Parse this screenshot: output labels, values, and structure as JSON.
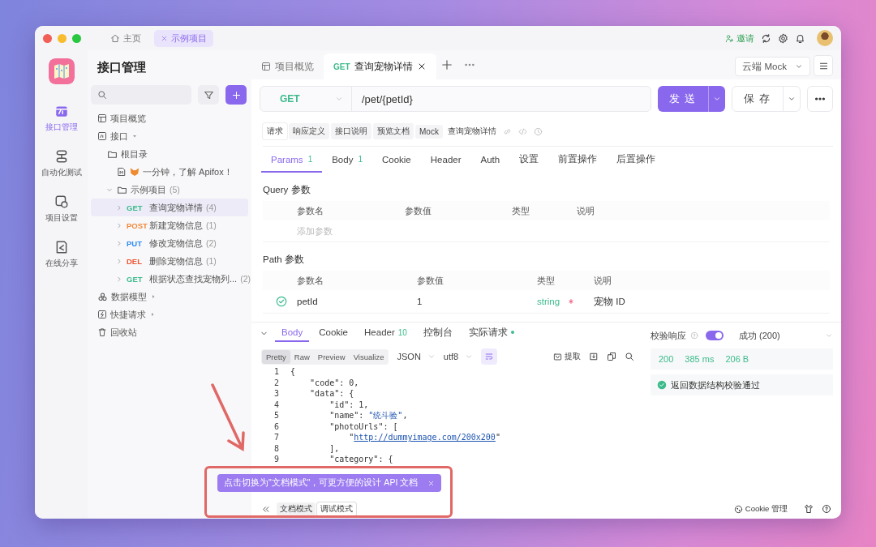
{
  "titlebar": {
    "tabs": [
      {
        "kind": "home",
        "label": "主页",
        "selected": false
      },
      {
        "kind": "project",
        "label": "示例项目",
        "selected": true
      }
    ],
    "invite": "邀请"
  },
  "nav": [
    {
      "kind": "api",
      "label": "接口管理",
      "selected": true
    },
    {
      "kind": "test",
      "label": "自动化测试",
      "selected": false
    },
    {
      "kind": "settings",
      "label": "项目设置",
      "selected": false
    },
    {
      "kind": "share",
      "label": "在线分享",
      "selected": false
    }
  ],
  "sidebar": {
    "title": "接口管理",
    "tree": [
      {
        "kind": "overview",
        "label": "项目概览",
        "selected": false
      },
      {
        "kind": "group",
        "label": "接口",
        "expanded": true,
        "selected": false,
        "children": [
          {
            "kind": "folder",
            "label": "根目录",
            "selected": false,
            "children": [
              {
                "kind": "doc",
                "label": "一分钟，了解 Apifox！",
                "selected": false
              },
              {
                "kind": "folder",
                "label": "示例项目",
                "count": "(5)",
                "expanded": true,
                "selected": false,
                "children": [
                  {
                    "kind": "endpoint",
                    "method": "GET",
                    "color": "#3dbb8c",
                    "label": "查询宠物详情",
                    "count": "(4)",
                    "expanded": false,
                    "selected": true
                  },
                  {
                    "kind": "endpoint",
                    "method": "POST",
                    "color": "#f0883a",
                    "label": "新建宠物信息",
                    "count": "(1)",
                    "expanded": false,
                    "selected": false
                  },
                  {
                    "kind": "endpoint",
                    "method": "PUT",
                    "color": "#2f8cf0",
                    "label": "修改宠物信息",
                    "count": "(2)",
                    "expanded": false,
                    "selected": false
                  },
                  {
                    "kind": "endpoint",
                    "method": "DEL",
                    "color": "#ee5533",
                    "label": "删除宠物信息",
                    "count": "(1)",
                    "expanded": false,
                    "selected": false
                  },
                  {
                    "kind": "endpoint",
                    "method": "GET",
                    "color": "#3dbb8c",
                    "label": "根据状态查找宠物列...",
                    "count": "(2)",
                    "expanded": false,
                    "selected": false
                  }
                ]
              }
            ]
          }
        ]
      },
      {
        "kind": "model",
        "label": "数据模型",
        "expanded": false,
        "selected": false
      },
      {
        "kind": "quick",
        "label": "快捷请求",
        "expanded": false,
        "selected": false
      },
      {
        "kind": "trash",
        "label": "回收站",
        "selected": false
      }
    ]
  },
  "tabs": [
    {
      "kind": "overview",
      "label": "项目概览",
      "selected": false,
      "closable": false
    },
    {
      "kind": "endpoint",
      "method": "GET",
      "label": "查询宠物详情",
      "selected": true,
      "closable": true
    }
  ],
  "environment": "云端 Mock",
  "request": {
    "method": "GET",
    "url": "/pet/{petId}",
    "send": "发送",
    "save": "保存"
  },
  "doc_tabs": [
    {
      "label": "请求",
      "selected": true
    },
    {
      "label": "响应定义",
      "selected": false
    },
    {
      "label": "接口说明",
      "selected": false
    },
    {
      "label": "预览文档",
      "selected": false
    },
    {
      "label": "Mock",
      "selected": false
    }
  ],
  "doc_title": "查询宠物详情",
  "param_tabs": [
    {
      "label": "Params",
      "count": "1",
      "selected": true
    },
    {
      "label": "Body",
      "count": "1",
      "selected": false
    },
    {
      "label": "Cookie",
      "selected": false
    },
    {
      "label": "Header",
      "selected": false
    },
    {
      "label": "Auth",
      "selected": false
    },
    {
      "label": "设置",
      "selected": false
    },
    {
      "label": "前置操作",
      "selected": false
    },
    {
      "label": "后置操作",
      "selected": false
    }
  ],
  "query": {
    "title": "Query 参数",
    "columns": [
      "参数名",
      "参数值",
      "类型",
      "说明"
    ],
    "placeholder": "添加参数"
  },
  "path": {
    "title": "Path 参数",
    "columns": [
      "参数名",
      "参数值",
      "类型",
      "说明"
    ],
    "rows": [
      {
        "enabled": true,
        "name": "petId",
        "value": "1",
        "type": "string",
        "required": true,
        "description": "宠物 ID"
      }
    ]
  },
  "response": {
    "tabs": [
      {
        "label": "Body",
        "selected": true
      },
      {
        "label": "Cookie",
        "selected": false
      },
      {
        "label": "Header",
        "count": "10",
        "selected": false
      },
      {
        "label": "控制台",
        "selected": false
      },
      {
        "label": "实际请求",
        "dot": true,
        "selected": false
      }
    ],
    "views": [
      {
        "label": "Pretty",
        "selected": true
      },
      {
        "label": "Raw",
        "selected": false
      },
      {
        "label": "Preview",
        "selected": false
      },
      {
        "label": "Visualize",
        "selected": false
      }
    ],
    "format": "JSON",
    "encoding": "utf8",
    "extract": "提取",
    "code": [
      {
        "n": "1",
        "text": "{"
      },
      {
        "n": "2",
        "text": "    \"code\": 0,"
      },
      {
        "n": "3",
        "text": "    \"data\": {"
      },
      {
        "n": "4",
        "text": "        \"id\": 1,"
      },
      {
        "n": "5",
        "text": "        \"name\": \"统斗验\","
      },
      {
        "n": "6",
        "text": "        \"photoUrls\": ["
      },
      {
        "n": "7",
        "text": "            \"http://dummyimage.com/200x200\"",
        "kind": "link"
      },
      {
        "n": "8",
        "text": "        ],"
      },
      {
        "n": "9",
        "text": "        \"category\": {"
      }
    ]
  },
  "validation": {
    "label": "校验响应",
    "enabled": true,
    "case": "成功 (200)",
    "status": "200",
    "time": "385 ms",
    "size": "206 B",
    "result": "返回数据结构校验通过"
  },
  "footer": {
    "modes": [
      {
        "label": "文档模式",
        "selected": false
      },
      {
        "label": "调试模式",
        "selected": true
      }
    ],
    "cookie": "Cookie 管理"
  },
  "tooltip": {
    "text": "点击切换为\"文档模式\"，可更方便的设计 API 文档"
  }
}
